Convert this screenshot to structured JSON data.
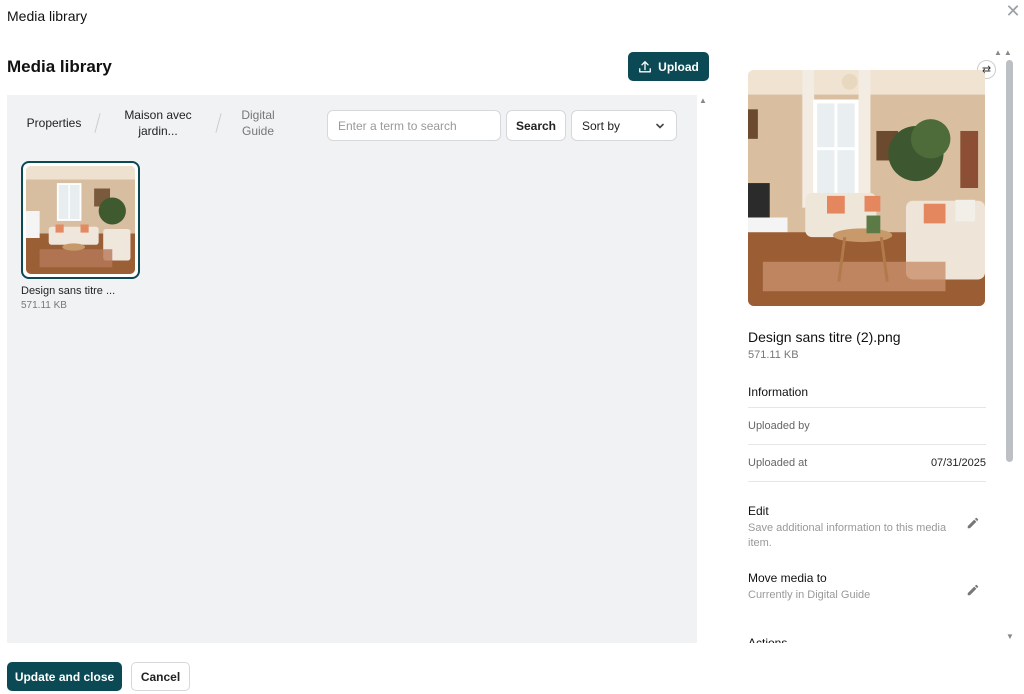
{
  "window": {
    "title": "Media library",
    "close_icon": "close-icon"
  },
  "page": {
    "title": "Media library"
  },
  "toolbar": {
    "upload_label": "Upload"
  },
  "breadcrumbs": [
    {
      "label": "Properties"
    },
    {
      "label": "Maison avec jardin..."
    },
    {
      "label": "Digital Guide"
    }
  ],
  "search": {
    "placeholder": "Enter a term to search",
    "value": "",
    "button_label": "Search"
  },
  "sort": {
    "label": "Sort by"
  },
  "media_items": [
    {
      "name": "Design sans titre ...",
      "size": "571.11 KB",
      "selected": true
    }
  ],
  "details": {
    "file_name": "Design sans titre (2).png",
    "file_size": "571.11 KB",
    "information_title": "Information",
    "rows": [
      {
        "label": "Uploaded by",
        "value": ""
      },
      {
        "label": "Uploaded at",
        "value": "07/31/2025"
      }
    ],
    "edit": {
      "title": "Edit",
      "description": "Save additional information to this media item."
    },
    "move": {
      "title": "Move media to",
      "description": "Currently in Digital Guide"
    },
    "actions_title": "Actions"
  },
  "footer": {
    "update_label": "Update and close",
    "cancel_label": "Cancel"
  },
  "colors": {
    "accent": "#0b4a55",
    "panel_bg": "#f1f2f4"
  }
}
